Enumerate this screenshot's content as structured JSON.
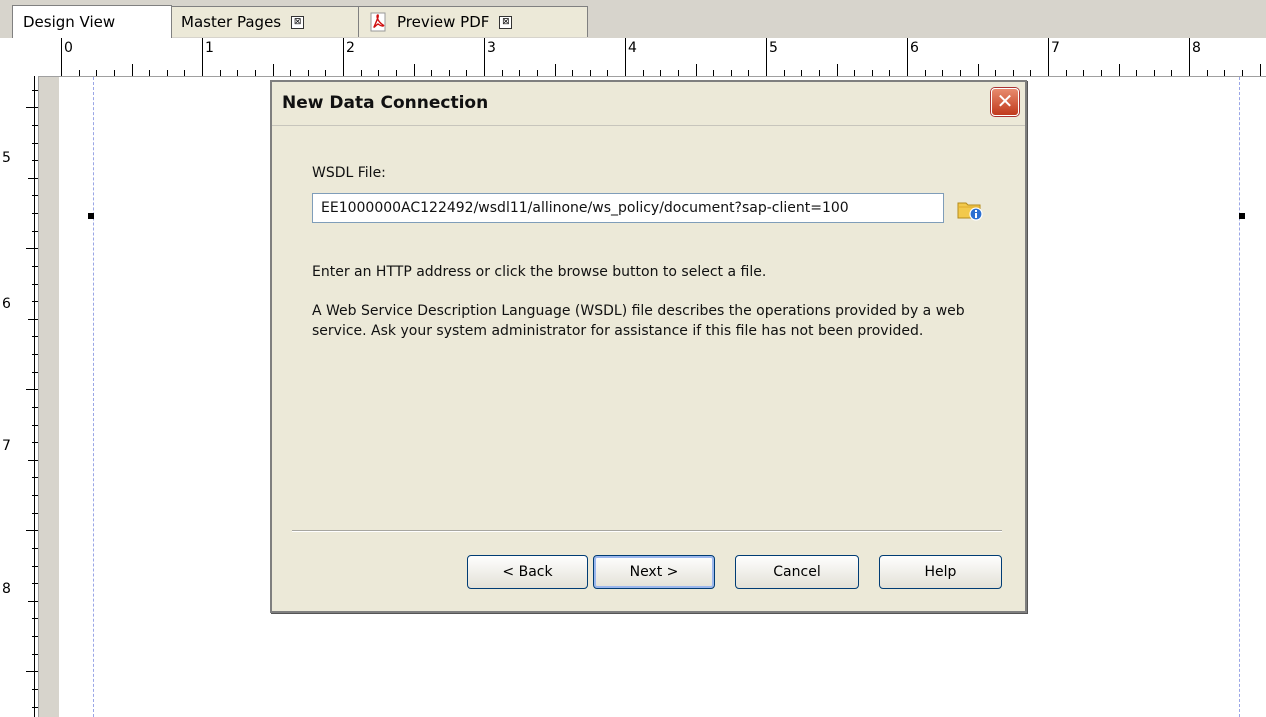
{
  "tabs": [
    {
      "label": "Design View",
      "active": true,
      "closable": false,
      "icon": null
    },
    {
      "label": "Master Pages",
      "active": false,
      "closable": true,
      "icon": null
    },
    {
      "label": "Preview PDF",
      "active": false,
      "closable": true,
      "icon": "pdf-icon"
    }
  ],
  "tab_close_glyph": "⊠",
  "ruler": {
    "horizontal": [
      "0",
      "1",
      "2",
      "3",
      "4",
      "5",
      "6",
      "7",
      "8"
    ],
    "vertical": [
      "5",
      "6",
      "7",
      "8"
    ]
  },
  "dialog": {
    "title": "New Data Connection",
    "close_glyph": "✕",
    "wsdl_label": "WSDL File:",
    "wsdl_value": "EE1000000AC122492/wsdl11/allinone/ws_policy/document?sap-client=100",
    "hint": "Enter an HTTP address or click the browse button to select a file.",
    "description": "A Web Service Description Language (WSDL) file describes the operations provided by a web service.  Ask your system administrator for assistance if this file has not been provided.",
    "buttons": {
      "back": "< Back",
      "next": "Next >",
      "cancel": "Cancel",
      "help": "Help"
    }
  },
  "colors": {
    "chrome": "#ece9d8",
    "close_red": "#c0391c",
    "button_border": "#003c74",
    "guide": "#9aa6e6"
  }
}
